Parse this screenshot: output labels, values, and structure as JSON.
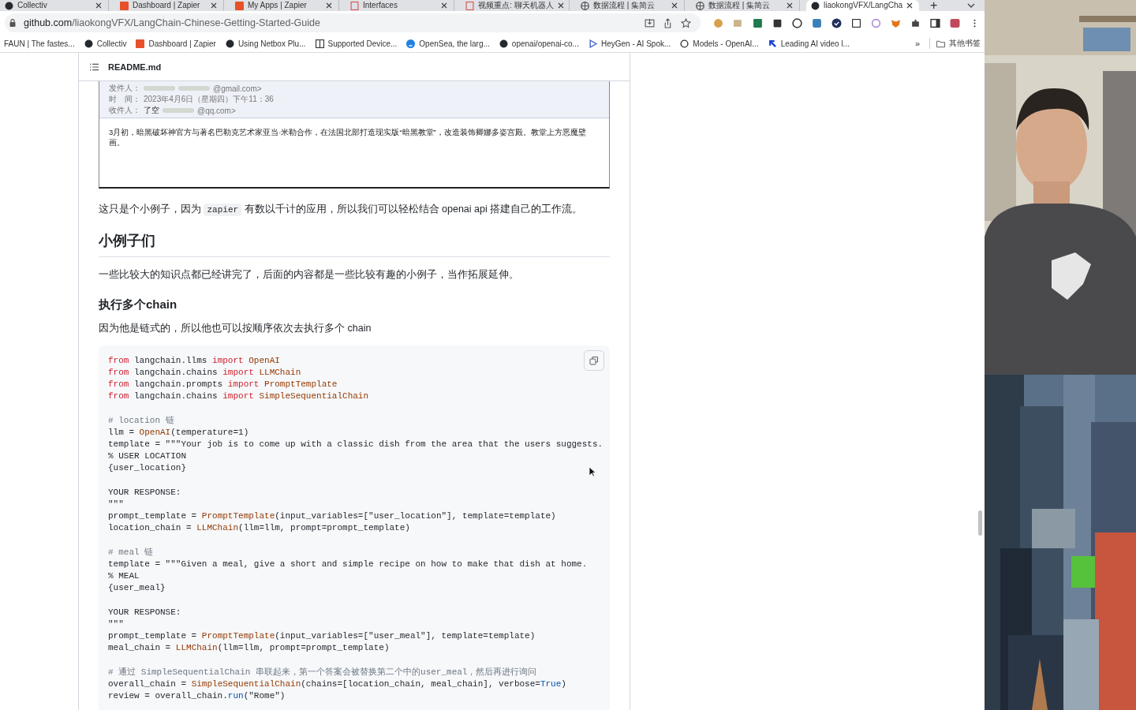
{
  "browser": {
    "tabs": [
      {
        "title": "Collectiv",
        "kind": "circle",
        "selected": false
      },
      {
        "title": "Dashboard | Zapier",
        "kind": "square",
        "selected": false
      },
      {
        "title": "My Apps | Zapier",
        "kind": "square",
        "selected": false
      },
      {
        "title": "Interfaces",
        "kind": "page",
        "selected": false
      },
      {
        "title": "视频重点: 聊天机器人",
        "kind": "page",
        "selected": false
      },
      {
        "title": "数据流程 | 集简云",
        "kind": "globe",
        "selected": false
      },
      {
        "title": "数据流程 | 集简云",
        "kind": "globe",
        "selected": false
      },
      {
        "title": "liaokongVFX/LangCha",
        "kind": "circle",
        "selected": true
      }
    ],
    "new_tab": "+",
    "address": {
      "host": "github.com",
      "path": "/liaokongVFX/LangChain-Chinese-Getting-Started-Guide"
    },
    "bookmarks": [
      {
        "title": "FAUN | The fastes...",
        "kind": "plain"
      },
      {
        "title": "Collectiv",
        "kind": "circle"
      },
      {
        "title": "Dashboard | Zapier",
        "kind": "square"
      },
      {
        "title": "Using Netbox Plu...",
        "kind": "circle"
      },
      {
        "title": "Supported Device...",
        "kind": "page"
      },
      {
        "title": "OpenSea, the larg...",
        "kind": "globe"
      },
      {
        "title": "openai/openai-co...",
        "kind": "circle"
      },
      {
        "title": "HeyGen - AI Spok...",
        "kind": "play"
      },
      {
        "title": "Models - OpenAI...",
        "kind": "knot"
      },
      {
        "title": "Leading AI video l...",
        "kind": "arrow"
      }
    ],
    "more_bookmarks": "»",
    "other_bookmarks": "其他书签"
  },
  "readme": {
    "file": "README.md",
    "email": {
      "from_label": "发件人：",
      "from_end": "@gmail.com>",
      "time_label": "时　间：",
      "time": "2023年4月6日（星期四）下午11：36",
      "to_label": "收件人：",
      "to_name": "了空",
      "to_end": "@qq.com>",
      "body": "3月初，暗黑破坏神官方与著名巴勒克艺术家亚当·米勒合作，在法国北部打造现实版“暗黑教堂”，改造装饰卿娜多姿宫殿。教堂上方恶魔壁画。"
    },
    "para_1": {
      "before": "这只是个小例子，因为 ",
      "code": "zapier",
      "after": " 有数以千计的应用，所以我们可以轻松结合 openai api 搭建自己的工作流。"
    },
    "heading_2": "小例子们",
    "para_2": "一些比较大的知识点都已经讲完了，后面的内容都是一些比较有趣的小例子，当作拓展延伸。",
    "heading_3": "执行多个chain",
    "para_3": "因为他是链式的，所以他也可以按顺序依次去执行多个 chain",
    "code_blocks": [
      [
        [
          {
            "kind": "kw",
            "text": "from"
          },
          {
            "kind": "tx",
            "text": " langchain.llms "
          },
          {
            "kind": "kw",
            "text": "import"
          },
          {
            "kind": "fn",
            "text": " OpenAI"
          }
        ],
        [
          {
            "kind": "kw",
            "text": "from"
          },
          {
            "kind": "tx",
            "text": " langchain.chains "
          },
          {
            "kind": "kw",
            "text": "import"
          },
          {
            "kind": "fn",
            "text": " LLMChain"
          }
        ],
        [
          {
            "kind": "kw",
            "text": "from"
          },
          {
            "kind": "tx",
            "text": " langchain.prompts "
          },
          {
            "kind": "kw",
            "text": "import"
          },
          {
            "kind": "fn",
            "text": " PromptTemplate"
          }
        ],
        [
          {
            "kind": "kw",
            "text": "from"
          },
          {
            "kind": "tx",
            "text": " langchain.chains "
          },
          {
            "kind": "kw",
            "text": "import"
          },
          {
            "kind": "fn",
            "text": " SimpleSequentialChain"
          }
        ]
      ],
      [
        [
          {
            "kind": "cm",
            "text": "# location 链"
          }
        ],
        [
          {
            "kind": "tx",
            "text": "llm = "
          },
          {
            "kind": "fn",
            "text": "OpenAI"
          },
          {
            "kind": "tx",
            "text": "(temperature=1)"
          }
        ],
        [
          {
            "kind": "tx",
            "text": "template = \"\"\"Your job is to come up with a classic dish from the area that the users suggests."
          }
        ],
        [
          {
            "kind": "tx",
            "text": "% USER LOCATION"
          }
        ],
        [
          {
            "kind": "tx",
            "text": "{user_location}"
          }
        ]
      ],
      [
        [
          {
            "kind": "tx",
            "text": "YOUR RESPONSE:"
          }
        ],
        [
          {
            "kind": "tx",
            "text": "\"\"\""
          }
        ],
        [
          {
            "kind": "tx",
            "text": "prompt_template = "
          },
          {
            "kind": "fn",
            "text": "PromptTemplate"
          },
          {
            "kind": "tx",
            "text": "(input_variables=[\"user_location\"], template=template)"
          }
        ],
        [
          {
            "kind": "tx",
            "text": "location_chain = "
          },
          {
            "kind": "fn",
            "text": "LLMChain"
          },
          {
            "kind": "tx",
            "text": "(llm=llm, prompt=prompt_template)"
          }
        ]
      ],
      [
        [
          {
            "kind": "cm",
            "text": "# meal 链"
          }
        ],
        [
          {
            "kind": "tx",
            "text": "template = \"\"\"Given a meal, give a short and simple recipe on how to make that dish at home."
          }
        ],
        [
          {
            "kind": "tx",
            "text": "% MEAL"
          }
        ],
        [
          {
            "kind": "tx",
            "text": "{user_meal}"
          }
        ]
      ],
      [
        [
          {
            "kind": "tx",
            "text": "YOUR RESPONSE:"
          }
        ],
        [
          {
            "kind": "tx",
            "text": "\"\"\""
          }
        ],
        [
          {
            "kind": "tx",
            "text": "prompt_template = "
          },
          {
            "kind": "fn",
            "text": "PromptTemplate"
          },
          {
            "kind": "tx",
            "text": "(input_variables=[\"user_meal\"], template=template)"
          }
        ],
        [
          {
            "kind": "tx",
            "text": "meal_chain = "
          },
          {
            "kind": "fn",
            "text": "LLMChain"
          },
          {
            "kind": "tx",
            "text": "(llm=llm, prompt=prompt_template)"
          }
        ]
      ],
      [
        [
          {
            "kind": "cm",
            "text": "# 通过 SimpleSequentialChain 串联起来，第一个答案会被替换第二个中的user_meal，然后再进行询问"
          }
        ],
        [
          {
            "kind": "tx",
            "text": "overall_chain = "
          },
          {
            "kind": "fn",
            "text": "SimpleSequentialChain"
          },
          {
            "kind": "tx",
            "text": "(chains=[location_chain, meal_chain], verbose="
          },
          {
            "kind": "bi",
            "text": "True"
          },
          {
            "kind": "tx",
            "text": ")"
          }
        ],
        [
          {
            "kind": "tx",
            "text": "review = overall_chain."
          },
          {
            "kind": "bi",
            "text": "run"
          },
          {
            "kind": "tx",
            "text": "(\"Rome\")"
          }
        ]
      ]
    ]
  }
}
